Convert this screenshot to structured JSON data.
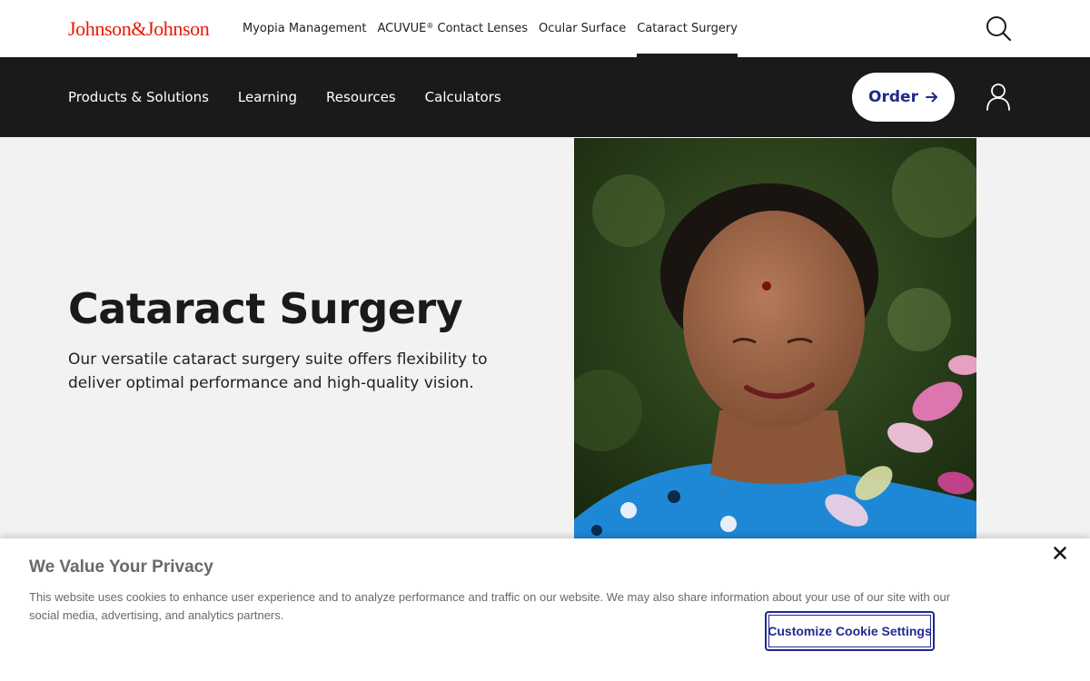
{
  "header": {
    "brand": "Johnson&Johnson",
    "top_links": [
      {
        "label": "Myopia Management"
      },
      {
        "label": "ACUVUE",
        "sup": "®",
        "suffix": " Contact Lenses"
      },
      {
        "label": "Ocular Surface"
      },
      {
        "label": "Cataract Surgery",
        "active": true
      }
    ],
    "search_icon": "search-icon"
  },
  "main_nav": {
    "items": [
      "Products & Solutions",
      "Learning",
      "Resources",
      "Calculators"
    ],
    "order_label": "Order",
    "order_icon": "arrow-right-icon",
    "user_icon": "user-icon"
  },
  "hero": {
    "title": "Cataract Surgery",
    "description": "Our versatile cataract surgery suite offers flexibility to deliver optimal performance and high-quality vision."
  },
  "cookie_banner": {
    "title": "We Value Your Privacy",
    "text": "This website uses cookies to enhance user experience and to analyze performance and traffic on our website. We may also share information about your use of our site with our social media, advertising, and analytics partners.",
    "button_label": "Customize Cookie Settings",
    "close_icon": "close-icon"
  },
  "colors": {
    "brand_red": "#eb1700",
    "nav_dark": "#1a1a1a",
    "accent_blue": "#1f2a8c",
    "hero_bg": "#f2f2f2"
  }
}
